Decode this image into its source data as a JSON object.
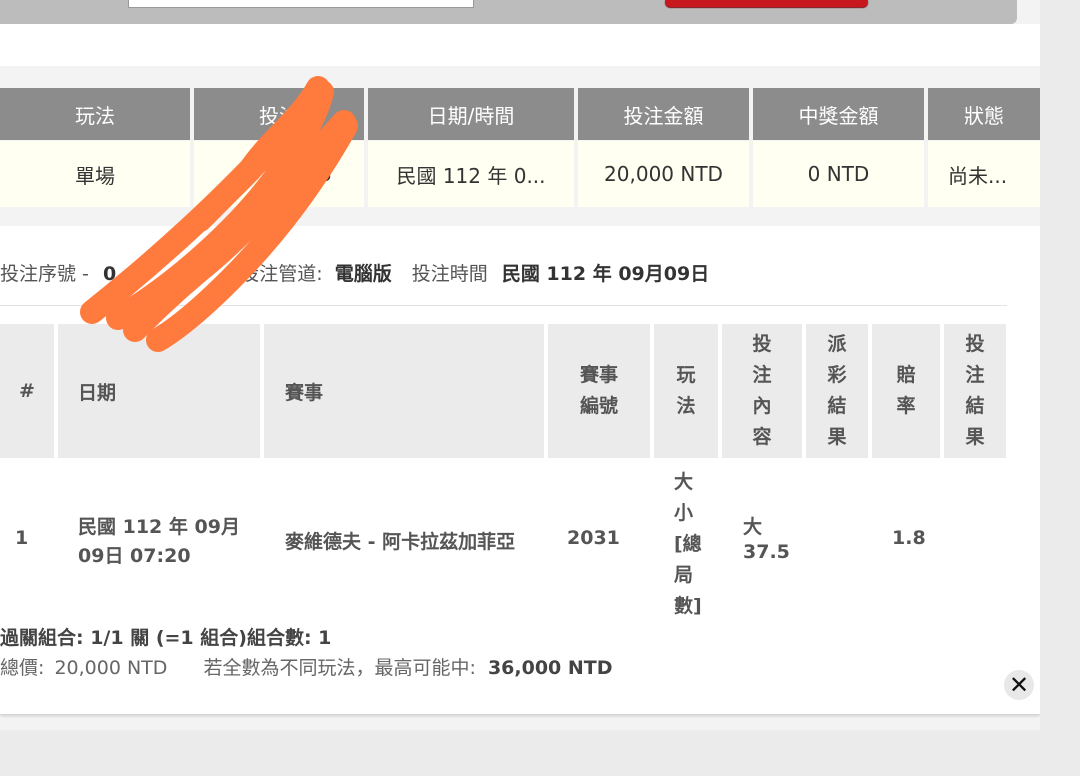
{
  "summary": {
    "headers": [
      "玩法",
      "投注",
      "日期/時間",
      "投注金額",
      "中獎金額",
      "狀態"
    ],
    "row": {
      "play_type": "單場",
      "bet_id_partial": "25",
      "datetime": "民國 112 年 0...",
      "bet_amount": "20,000 NTD",
      "win_amount": "0 NTD",
      "status": "尚未..."
    }
  },
  "detail": {
    "serial_label": "投注序號 -",
    "serial_value": "0",
    "channel_label": "投注管道:",
    "channel_value": "電腦版",
    "time_label": "投注時間",
    "time_value": "民國 112 年 09月09日",
    "table": {
      "headers": {
        "num": "#",
        "date": "日期",
        "match": "賽事",
        "match_no": "賽事編號",
        "play": "玩法",
        "bet_content": "投注內容",
        "payout_result": "派彩結果",
        "odds": "賠率",
        "bet_result": "投注結果"
      },
      "rows": [
        {
          "num": "1",
          "date_line1": "民國 112 年 09月",
          "date_line2": "09日 07:20",
          "match": "麥維德夫 - 阿卡拉茲加菲亞",
          "match_no": "2031",
          "play_lines": [
            "大",
            "小",
            "[總",
            "局",
            "數]"
          ],
          "bet_line1": "大",
          "bet_line2": "37.5",
          "payout_result": "",
          "odds": "1.8",
          "bet_result": ""
        }
      ]
    },
    "parlay_text": "過關組合: 1/1 關 (=1 組合)組合數: 1",
    "total_label": "總價:",
    "total_value": "20,000 NTD",
    "max_label": "若全數為不同玩法，最高可能中:",
    "max_value": "36,000 NTD"
  },
  "colors": {
    "header_gray": "#8c8c8c",
    "row_cream": "#fffff2",
    "button_red": "#c8171d",
    "scribble_orange": "#ff7a3d"
  },
  "icons": {
    "close": "close-icon"
  }
}
